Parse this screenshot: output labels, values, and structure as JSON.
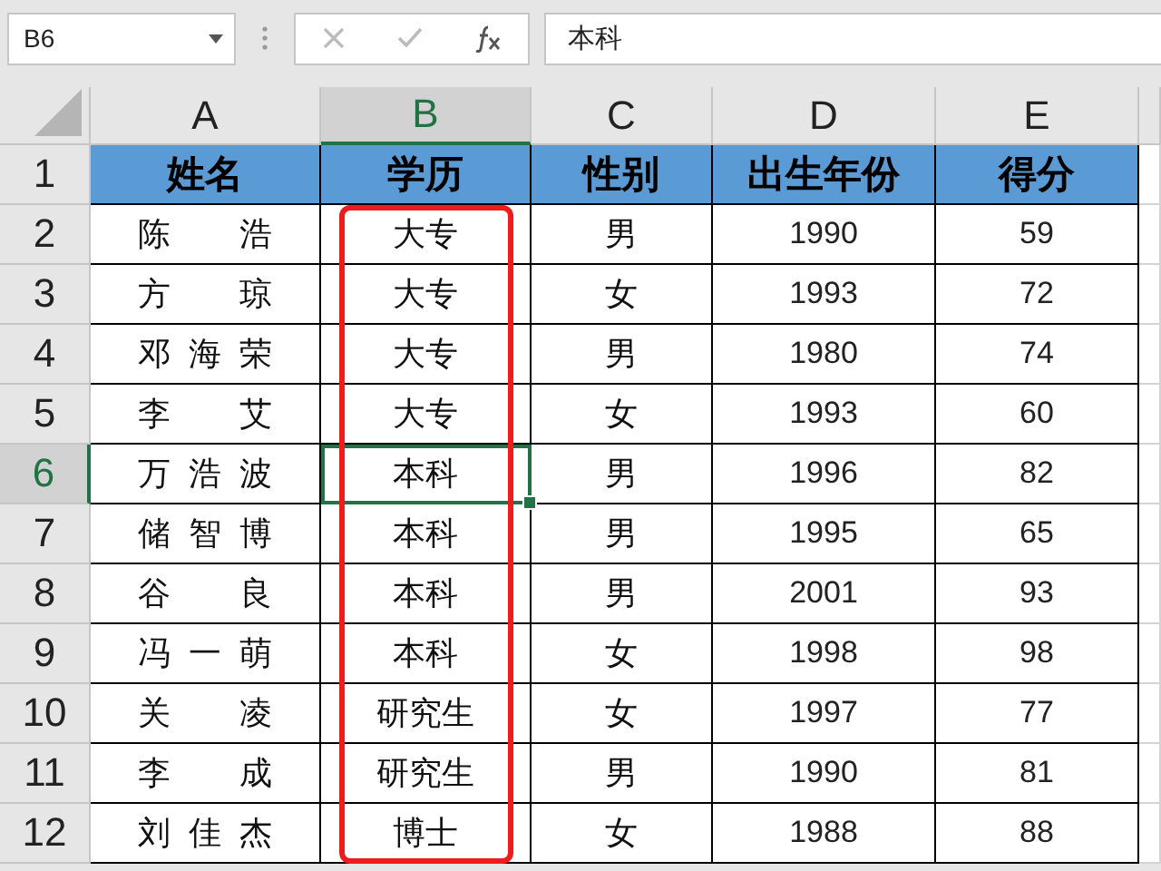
{
  "name_box": {
    "value": "B6"
  },
  "formula_bar": {
    "value": "本科"
  },
  "columns": [
    {
      "letter": "A",
      "selected": false,
      "outlined": false
    },
    {
      "letter": "B",
      "selected": true,
      "outlined": true
    },
    {
      "letter": "C",
      "selected": false,
      "outlined": false
    },
    {
      "letter": "D",
      "selected": false,
      "outlined": false
    },
    {
      "letter": "E",
      "selected": false,
      "outlined": false
    }
  ],
  "rows": [
    {
      "number": "1",
      "selected": false,
      "kind": "header",
      "cells": [
        "姓名",
        "学历",
        "性别",
        "出生年份",
        "得分"
      ]
    },
    {
      "number": "2",
      "selected": false,
      "kind": "data",
      "cells": [
        "陈浩",
        "大专",
        "男",
        "1990",
        "59"
      ]
    },
    {
      "number": "3",
      "selected": false,
      "kind": "data",
      "cells": [
        "方琼",
        "大专",
        "女",
        "1993",
        "72"
      ]
    },
    {
      "number": "4",
      "selected": false,
      "kind": "data",
      "cells": [
        "邓海荣",
        "大专",
        "男",
        "1980",
        "74"
      ]
    },
    {
      "number": "5",
      "selected": false,
      "kind": "data",
      "cells": [
        "李艾",
        "大专",
        "女",
        "1993",
        "60"
      ]
    },
    {
      "number": "6",
      "selected": true,
      "kind": "data",
      "cells": [
        "万浩波",
        "本科",
        "男",
        "1996",
        "82"
      ]
    },
    {
      "number": "7",
      "selected": false,
      "kind": "data",
      "cells": [
        "储智博",
        "本科",
        "男",
        "1995",
        "65"
      ]
    },
    {
      "number": "8",
      "selected": false,
      "kind": "data",
      "cells": [
        "谷良",
        "本科",
        "男",
        "2001",
        "93"
      ]
    },
    {
      "number": "9",
      "selected": false,
      "kind": "data",
      "cells": [
        "冯一萌",
        "本科",
        "女",
        "1998",
        "98"
      ]
    },
    {
      "number": "10",
      "selected": false,
      "kind": "data",
      "cells": [
        "关凌",
        "研究生",
        "女",
        "1997",
        "77"
      ]
    },
    {
      "number": "11",
      "selected": false,
      "kind": "data",
      "cells": [
        "李成",
        "研究生",
        "男",
        "1990",
        "81"
      ]
    },
    {
      "number": "12",
      "selected": false,
      "kind": "data",
      "cells": [
        "刘佳杰",
        "博士",
        "女",
        "1988",
        "88"
      ]
    }
  ]
}
